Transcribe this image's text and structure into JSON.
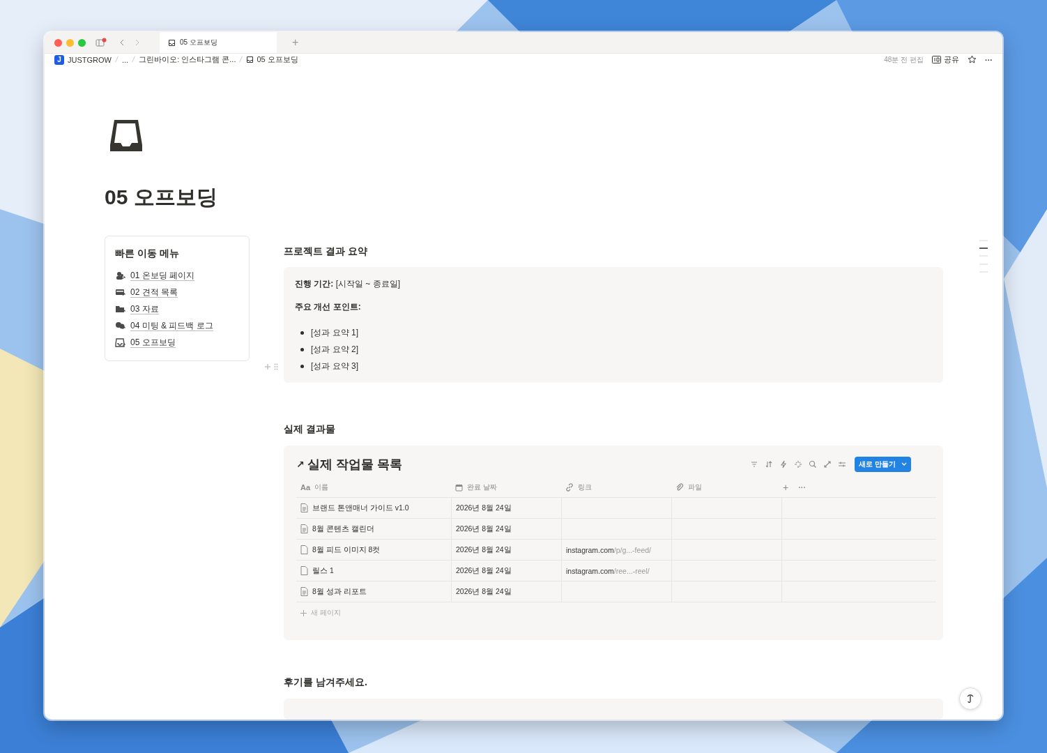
{
  "browser": {
    "tab_title": "05 오프보딩",
    "new_tab": "+"
  },
  "breadcrumbs": {
    "logo": "J",
    "items": [
      {
        "label": "JUSTGROW",
        "kind": "workspace"
      },
      {
        "label": "...",
        "kind": "plain"
      },
      {
        "label": "그린바이오: 인스타그램 콘...",
        "kind": "plain"
      },
      {
        "label": "05 오프보딩",
        "kind": "page"
      }
    ]
  },
  "topbar": {
    "edited": "48분 전 편집",
    "share": "공유",
    "more": "···"
  },
  "page": {
    "title": "05 오프보딩"
  },
  "quick_menu": {
    "title": "빠른 이동 메뉴",
    "items": [
      {
        "label": "01 온보딩 페이지",
        "kind": "people"
      },
      {
        "label": "02 견적 목록",
        "kind": "card"
      },
      {
        "label": "03 자료",
        "kind": "folder"
      },
      {
        "label": "04 미팅 & 피드백 로그",
        "kind": "chat"
      },
      {
        "label": "05 오프보딩",
        "kind": "inbox"
      }
    ]
  },
  "summary": {
    "heading": "프로젝트 결과 요약",
    "period_label": "진행 기간:",
    "period_value": "[시작일 ~ 종료일]",
    "points_label": "주요 개선 포인트:",
    "bullets": [
      "[성과 요약 1]",
      "[성과 요약 2]",
      "[성과 요약 3]"
    ]
  },
  "results": {
    "heading": "실제 결과물",
    "db_arrow": "↗",
    "db_title": "실제 작업물 목록",
    "new_button": "새로 만들기",
    "columns": [
      {
        "label": "이름",
        "kind": "title",
        "icon_text": "Aa"
      },
      {
        "label": "완료 날짜",
        "kind": "date"
      },
      {
        "label": "링크",
        "kind": "url"
      },
      {
        "label": "파일",
        "kind": "file"
      }
    ],
    "add_column": "+",
    "column_more": "···",
    "rows": [
      {
        "name": "브랜드 톤앤매너 가이드 v1.0",
        "date": "2026년 8월 24일",
        "doc": true
      },
      {
        "name": "8월 콘텐츠 캘린더",
        "date": "2026년 8월 24일",
        "doc": true
      },
      {
        "name": "8월 피드 이미지 8컷",
        "date": "2026년 8월 24일",
        "doc": false,
        "link_host": "instagram.com",
        "link_path": "/p/g...-feed/"
      },
      {
        "name": "릴스 1",
        "date": "2026년 8월 24일",
        "doc": false,
        "link_host": "instagram.com",
        "link_path": "/ree...-reel/"
      },
      {
        "name": "8월 성과 리포트",
        "date": "2026년 8월 24일",
        "doc": true
      }
    ],
    "new_page": "새 페이지"
  },
  "review": {
    "heading": "후기를 남겨주세요."
  }
}
